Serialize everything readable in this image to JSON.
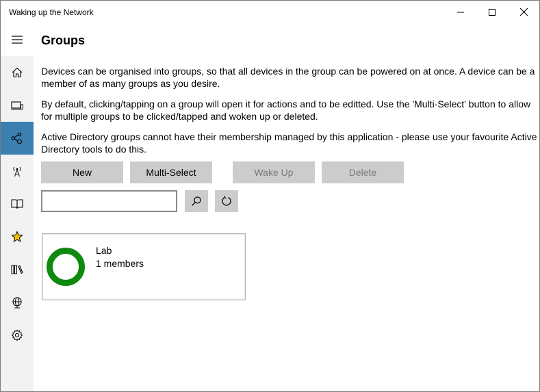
{
  "window": {
    "title": "Waking up the Network"
  },
  "nav": {
    "items": [
      {
        "id": "home",
        "icon": "home-icon"
      },
      {
        "id": "devices",
        "icon": "device-icon"
      },
      {
        "id": "groups",
        "icon": "share-nodes-icon",
        "selected": true
      },
      {
        "id": "network",
        "icon": "antenna-icon"
      },
      {
        "id": "docs",
        "icon": "book-icon"
      },
      {
        "id": "favourites",
        "icon": "star-icon"
      },
      {
        "id": "library",
        "icon": "library-icon"
      },
      {
        "id": "web",
        "icon": "globe-icon"
      },
      {
        "id": "settings",
        "icon": "gear-icon"
      }
    ],
    "accent_color": "#3c7fb1",
    "star_color": "#f2c200"
  },
  "page": {
    "title": "Groups",
    "paragraphs": [
      "Devices can be organised into groups, so that all devices in the group can be powered on at once. A device can be a member of as many groups as you desire.",
      "By default, clicking/tapping on a group will open it for actions and to be editted. Use the 'Multi-Select' button to allow for multiple groups to be clicked/tapped and woken up or deleted.",
      "Active Directory groups cannot have their membership managed by this application - please use your favourite Active Directory tools to do this."
    ]
  },
  "toolbar": {
    "new_label": "New",
    "multi_select_label": "Multi-Select",
    "wake_up_label": "Wake Up",
    "delete_label": "Delete"
  },
  "search": {
    "value": "",
    "placeholder": ""
  },
  "groups": [
    {
      "name": "Lab",
      "members": "1 members",
      "ring_color": "#0f8a0f"
    }
  ]
}
